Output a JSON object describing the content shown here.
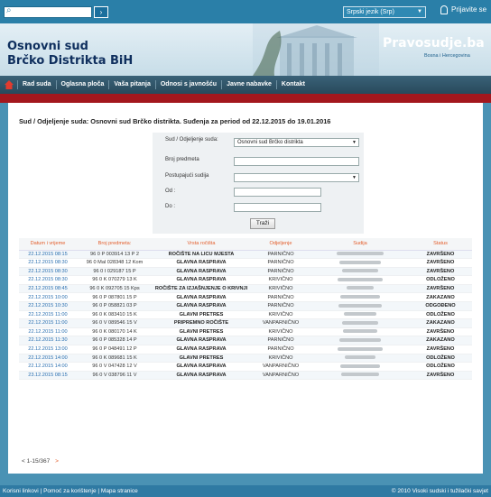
{
  "topbar": {
    "search_placeholder": "",
    "search_go": "›",
    "language": "Srpski jezik (Srp)",
    "login": "Prijavite se"
  },
  "header": {
    "court_line1": "Osnovni sud",
    "court_line2": "Brčko Distrikta BiH",
    "brand": "Pravosudje.ba",
    "brand_sub": "Bosna i Hercegovina"
  },
  "nav": {
    "items": [
      "Rad suda",
      "Oglasna ploča",
      "Vaša pitanja",
      "Odnosi s javnošću",
      "Javne nabavke",
      "Kontakt"
    ]
  },
  "main": {
    "title": "Sud / Odjeljenje suda: Osnovni sud Brčko distrikta. Suđenja za period od 22.12.2015 do 19.01.2016"
  },
  "form": {
    "court_label": "Sud / Odjeljenje suda:",
    "court_value": "Osnovni sud Brčko distrikta",
    "case_label": "Broj predmeta",
    "judge_label": "Postupajući sudija",
    "from_label": "Od :",
    "to_label": "Do :",
    "search_button": "Traži"
  },
  "table": {
    "headers": [
      "Datum i vrijeme",
      "Broj predmeta:",
      "Vrsta ročišta",
      "Odjeljenje",
      "Sudija",
      "Status"
    ],
    "rows": [
      [
        "22.12.2015 08:15",
        "96 0 P 003914 13 P 2",
        "ROČIŠTE NA LICU MJESTA",
        "PARNIČNO",
        "ZAVRŠENO"
      ],
      [
        "22.12.2015 08:30",
        "96 0 Mal 028348 12 Kom",
        "GLAVNA RASPRAVA",
        "PARNIČNO",
        "ZAVRŠENO"
      ],
      [
        "22.12.2015 08:30",
        "96 0 I 029187 15 P",
        "GLAVNA RASPRAVA",
        "PARNIČNO",
        "ZAVRŠENO"
      ],
      [
        "22.12.2015 08:30",
        "96 0 K 070279 13 K",
        "GLAVNA RASPRAVA",
        "KRIVIČNO",
        "ODLOŽENO"
      ],
      [
        "22.12.2015 08:45",
        "96 0 K 092705 15 Kps",
        "ROČIŠTE ZA IZJAŠNJENJE O KRIVNJI",
        "KRIVIČNO",
        "ZAVRŠENO"
      ],
      [
        "22.12.2015 10:00",
        "96 0 P 087801 15 P",
        "GLAVNA RASPRAVA",
        "PARNIČNO",
        "ZAKAZANO"
      ],
      [
        "22.12.2015 10:30",
        "96 0 P 058821 03 P",
        "GLAVNA RASPRAVA",
        "PARNIČNO",
        "ODGOĐENO"
      ],
      [
        "22.12.2015 11:00",
        "96 0 K 083410 15 K",
        "GLAVNI PRETRES",
        "KRIVIČNO",
        "ODLOŽENO"
      ],
      [
        "22.12.2015 11:00",
        "96 0 V 089546 15 V",
        "PRIPREMNO ROČIŠTE",
        "VANPARNIČNO",
        "ZAKAZANO"
      ],
      [
        "22.12.2015 11:00",
        "96 0 K 080170 14 K",
        "GLAVNI PRETRES",
        "KRIVIČNO",
        "ZAVRŠENO"
      ],
      [
        "22.12.2015 11:30",
        "96 0 P 085328 14 P",
        "GLAVNA RASPRAVA",
        "PARNIČNO",
        "ZAKAZANO"
      ],
      [
        "22.12.2015 13:00",
        "96 0 P 048491 12 P",
        "GLAVNA RASPRAVA",
        "PARNIČNO",
        "ZAVRŠENO"
      ],
      [
        "22.12.2015 14:00",
        "96 0 K 089681 15 K",
        "GLAVNI PRETRES",
        "KRIVIČNO",
        "ODLOŽENO"
      ],
      [
        "22.12.2015 14:00",
        "96 0 V 047428 12 V",
        "GLAVNA RASPRAVA",
        "VANPARNIČNO",
        "ODLOŽENO"
      ],
      [
        "23.12.2015 08:15",
        "96 0 V 038796 11 V",
        "GLAVNA RASPRAVA",
        "VANPARNIČNO",
        "ZAVRŠENO"
      ]
    ]
  },
  "pager": {
    "prev": "<",
    "range": "1-15/367",
    "next": ">"
  },
  "footer": {
    "links": [
      "Korisni linkovi",
      "Pomoć za korištenje",
      "Mapa stranice"
    ],
    "copyright": "© 2010 Visoki sudski i tužilački savjet"
  }
}
